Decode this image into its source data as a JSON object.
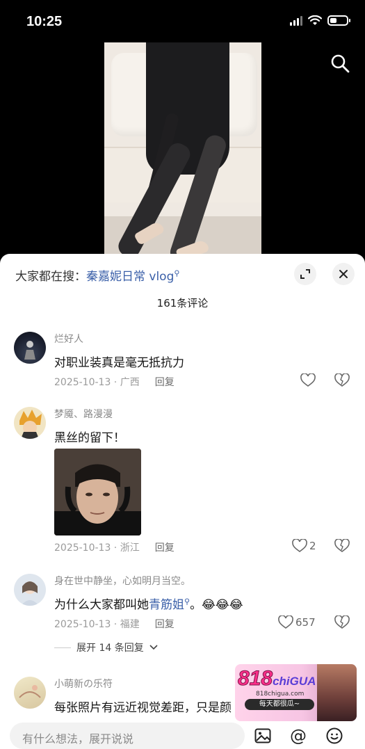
{
  "status_bar": {
    "time": "10:25"
  },
  "video": {
    "search_icon": "search-icon"
  },
  "sheet": {
    "trending_prefix": "大家都在搜：",
    "trending_keyword": "秦嘉妮日常 vlog",
    "comment_count": "161条评论"
  },
  "comments": [
    {
      "username": "烂好人",
      "text": "对职业装真是毫无抵抗力",
      "meta": "2025-10-13 · 广西",
      "reply": "回复",
      "likes": ""
    },
    {
      "username": "梦魇、路漫漫",
      "text": "黑丝的留下！",
      "meta": "2025-10-13 · 浙江",
      "reply": "回复",
      "likes": "2"
    },
    {
      "username": "身在世中静坐，心如明月当空。",
      "text_before": "为什么大家都叫她",
      "text_link": "青筋姐",
      "text_after": "。😂😂😂",
      "meta": "2025-10-13 · 福建",
      "reply": "回复",
      "likes": "657",
      "expand": "展开 14 条回复"
    },
    {
      "username": "小萌新の乐符",
      "text": "每张照片有远近视觉差距，只是颜"
    }
  ],
  "watermark": {
    "logo_main": "818",
    "logo_sub": "chiGUA",
    "site": "818chigua.com",
    "slogan": "每天都很瓜~"
  },
  "input_bar": {
    "placeholder": "有什么想法，展开说说",
    "at_symbol": "@"
  }
}
